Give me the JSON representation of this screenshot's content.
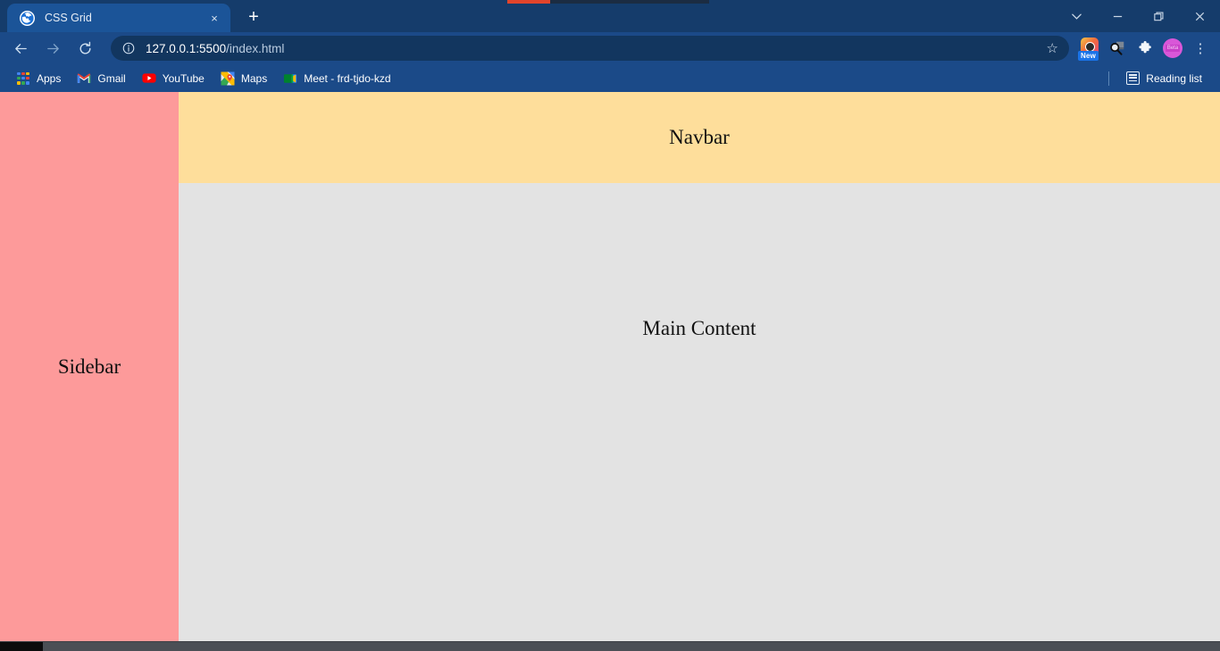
{
  "browser": {
    "tab": {
      "title": "CSS Grid",
      "favicon": "globe-icon",
      "close_label": "×"
    },
    "newtab_label": "+",
    "window_controls": {
      "tab_search": "tab-search-icon",
      "minimize": "—",
      "maximize": "maximize-icon",
      "close": "✕"
    },
    "toolbar": {
      "back": "back-arrow-icon",
      "forward": "forward-arrow-icon",
      "reload": "reload-icon",
      "site_info": "info-icon",
      "url_host": "127.0.0.1:5500",
      "url_path": "/index.html",
      "url_full": "127.0.0.1:5500/index.html",
      "bookmark_star": "☆",
      "extensions": [
        {
          "name": "camera-extension-icon",
          "badge": "New"
        },
        {
          "name": "search-extension-icon",
          "badge": ""
        },
        {
          "name": "puzzle-extensions-icon",
          "badge": ""
        }
      ],
      "avatar": {
        "name": "profile-avatar",
        "label": "Beta"
      },
      "menu": "⋮"
    },
    "bookmarks": {
      "items": [
        {
          "label": "Apps",
          "icon": "apps-grid-icon"
        },
        {
          "label": "Gmail",
          "icon": "gmail-icon"
        },
        {
          "label": "YouTube",
          "icon": "youtube-icon"
        },
        {
          "label": "Maps",
          "icon": "maps-icon"
        },
        {
          "label": "Meet - frd-tjdo-kzd",
          "icon": "meet-icon"
        }
      ],
      "reading_list": {
        "label": "Reading list",
        "icon": "reading-list-icon"
      }
    }
  },
  "page": {
    "sidebar": {
      "label": "Sidebar",
      "color": "#FD9A9A"
    },
    "navbar": {
      "label": "Navbar",
      "color": "#FEDE9B"
    },
    "main": {
      "label": "Main Content",
      "color": "#E3E3E3"
    }
  },
  "colors": {
    "chrome_frame": "#153C6B",
    "toolbar": "#1B4A88",
    "active_tab": "#1B5498",
    "omnibox": "#12365F",
    "accent_blue": "#1A73E8"
  }
}
